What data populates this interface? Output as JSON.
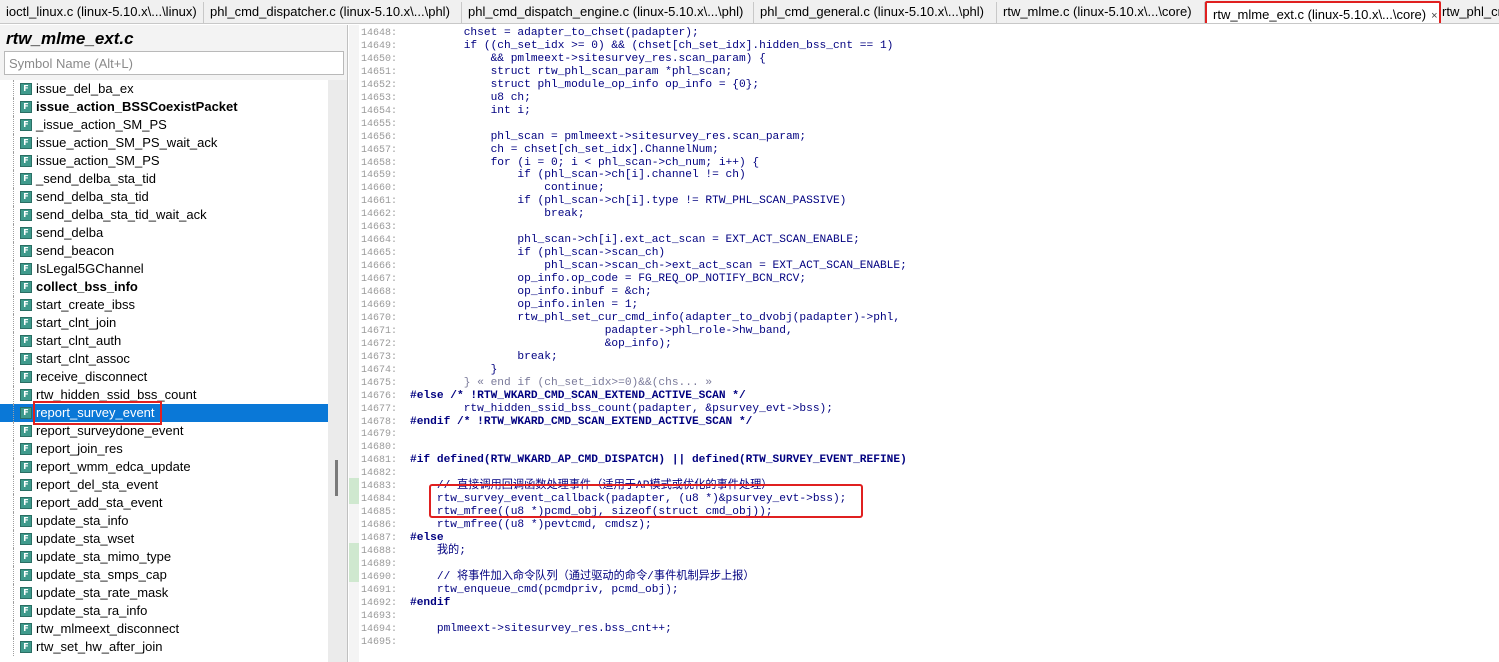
{
  "tabs": [
    {
      "label": "ioctl_linux.c (linux-5.10.x\\...\\linux)",
      "active": false
    },
    {
      "label": "phl_cmd_dispatcher.c (linux-5.10.x\\...\\phl)",
      "active": false
    },
    {
      "label": "phl_cmd_dispatch_engine.c (linux-5.10.x\\...\\phl)",
      "active": false
    },
    {
      "label": "phl_cmd_general.c (linux-5.10.x\\...\\phl)",
      "active": false
    },
    {
      "label": "rtw_mlme.c (linux-5.10.x\\...\\core)",
      "active": false
    },
    {
      "label": "rtw_mlme_ext.c (linux-5.10.x\\...\\core)",
      "active": true
    },
    {
      "label": "rtw_phl_cn",
      "active": false
    }
  ],
  "tab_close_glyph": "×",
  "sidebar": {
    "title": "rtw_mlme_ext.c",
    "search_placeholder": "Symbol Name (Alt+L)",
    "symbols": [
      {
        "label": "issue_del_ba_ex",
        "bold": false
      },
      {
        "label": "issue_action_BSSCoexistPacket",
        "bold": true
      },
      {
        "label": "_issue_action_SM_PS",
        "bold": false
      },
      {
        "label": "issue_action_SM_PS_wait_ack",
        "bold": false
      },
      {
        "label": "issue_action_SM_PS",
        "bold": false
      },
      {
        "label": "_send_delba_sta_tid",
        "bold": false
      },
      {
        "label": "send_delba_sta_tid",
        "bold": false
      },
      {
        "label": "send_delba_sta_tid_wait_ack",
        "bold": false
      },
      {
        "label": "send_delba",
        "bold": false
      },
      {
        "label": "send_beacon",
        "bold": false
      },
      {
        "label": "IsLegal5GChannel",
        "bold": false
      },
      {
        "label": "collect_bss_info",
        "bold": true
      },
      {
        "label": "start_create_ibss",
        "bold": false
      },
      {
        "label": "start_clnt_join",
        "bold": false
      },
      {
        "label": "start_clnt_auth",
        "bold": false
      },
      {
        "label": "start_clnt_assoc",
        "bold": false
      },
      {
        "label": "receive_disconnect",
        "bold": false
      },
      {
        "label": "rtw_hidden_ssid_bss_count",
        "bold": false
      },
      {
        "label": "report_survey_event",
        "bold": false,
        "selected": true
      },
      {
        "label": "report_surveydone_event",
        "bold": false
      },
      {
        "label": "report_join_res",
        "bold": false
      },
      {
        "label": "report_wmm_edca_update",
        "bold": false
      },
      {
        "label": "report_del_sta_event",
        "bold": false
      },
      {
        "label": "report_add_sta_event",
        "bold": false
      },
      {
        "label": "update_sta_info",
        "bold": false
      },
      {
        "label": "update_sta_wset",
        "bold": false
      },
      {
        "label": "update_sta_mimo_type",
        "bold": false
      },
      {
        "label": "update_sta_smps_cap",
        "bold": false
      },
      {
        "label": "update_sta_rate_mask",
        "bold": false
      },
      {
        "label": "update_sta_ra_info",
        "bold": false
      },
      {
        "label": "rtw_mlmeext_disconnect",
        "bold": false
      },
      {
        "label": "rtw_set_hw_after_join",
        "bold": false
      }
    ]
  },
  "editor": {
    "lines": [
      {
        "num": "14648:",
        "text": "        chset = adapter_to_chset(padapter);"
      },
      {
        "num": "14649:",
        "text": "        if ((ch_set_idx >= 0) && (chset[ch_set_idx].hidden_bss_cnt == 1)"
      },
      {
        "num": "14650:",
        "text": "            && pmlmeext->sitesurvey_res.scan_param) {"
      },
      {
        "num": "14651:",
        "text": "            struct rtw_phl_scan_param *phl_scan;"
      },
      {
        "num": "14652:",
        "text": "            struct phl_module_op_info op_info = {0};"
      },
      {
        "num": "14653:",
        "text": "            u8 ch;"
      },
      {
        "num": "14654:",
        "text": "            int i;"
      },
      {
        "num": "14655:",
        "text": ""
      },
      {
        "num": "14656:",
        "text": "            phl_scan = pmlmeext->sitesurvey_res.scan_param;"
      },
      {
        "num": "14657:",
        "text": "            ch = chset[ch_set_idx].ChannelNum;"
      },
      {
        "num": "14658:",
        "text": "            for (i = 0; i < phl_scan->ch_num; i++) {"
      },
      {
        "num": "14659:",
        "text": "                if (phl_scan->ch[i].channel != ch)"
      },
      {
        "num": "14660:",
        "text": "                    continue;"
      },
      {
        "num": "14661:",
        "text": "                if (phl_scan->ch[i].type != RTW_PHL_SCAN_PASSIVE)"
      },
      {
        "num": "14662:",
        "text": "                    break;"
      },
      {
        "num": "14663:",
        "text": ""
      },
      {
        "num": "14664:",
        "text": "                phl_scan->ch[i].ext_act_scan = EXT_ACT_SCAN_ENABLE;"
      },
      {
        "num": "14665:",
        "text": "                if (phl_scan->scan_ch)"
      },
      {
        "num": "14666:",
        "text": "                    phl_scan->scan_ch->ext_act_scan = EXT_ACT_SCAN_ENABLE;"
      },
      {
        "num": "14667:",
        "text": "                op_info.op_code = FG_REQ_OP_NOTIFY_BCN_RCV;"
      },
      {
        "num": "14668:",
        "text": "                op_info.inbuf = &ch;"
      },
      {
        "num": "14669:",
        "text": "                op_info.inlen = 1;"
      },
      {
        "num": "14670:",
        "text": "                rtw_phl_set_cur_cmd_info(adapter_to_dvobj(padapter)->phl,"
      },
      {
        "num": "14671:",
        "text": "                             padapter->phl_role->hw_band,"
      },
      {
        "num": "14672:",
        "text": "                             &op_info);"
      },
      {
        "num": "14673:",
        "text": "                break;"
      },
      {
        "num": "14674:",
        "text": "            }"
      },
      {
        "num": "14675:",
        "text": "        } « end if (ch_set_idx>=0)&&(chs... »"
      },
      {
        "num": "14676:",
        "text": "#else /* !RTW_WKARD_CMD_SCAN_EXTEND_ACTIVE_SCAN */"
      },
      {
        "num": "14677:",
        "text": "        rtw_hidden_ssid_bss_count(padapter, &psurvey_evt->bss);"
      },
      {
        "num": "14678:",
        "text": "#endif /* !RTW_WKARD_CMD_SCAN_EXTEND_ACTIVE_SCAN */"
      },
      {
        "num": "14679:",
        "text": ""
      },
      {
        "num": "14680:",
        "text": ""
      },
      {
        "num": "14681:",
        "text": "#if defined(RTW_WKARD_AP_CMD_DISPATCH) || defined(RTW_SURVEY_EVENT_REFINE)"
      },
      {
        "num": "14682:",
        "text": ""
      },
      {
        "num": "14683:",
        "text": "    // 直接调用回调函数处理事件（适用于AP模式或优化的事件处理）"
      },
      {
        "num": "14684:",
        "text": "    rtw_survey_event_callback(padapter, (u8 *)&psurvey_evt->bss);"
      },
      {
        "num": "14685:",
        "text": "    rtw_mfree((u8 *)pcmd_obj, sizeof(struct cmd_obj));"
      },
      {
        "num": "14686:",
        "text": "    rtw_mfree((u8 *)pevtcmd, cmdsz);"
      },
      {
        "num": "14687:",
        "text": "#else"
      },
      {
        "num": "14688:",
        "text": "    我的;"
      },
      {
        "num": "14689:",
        "text": ""
      },
      {
        "num": "14690:",
        "text": "    // 将事件加入命令队列（通过驱动的命令/事件机制异步上报）"
      },
      {
        "num": "14691:",
        "text": "    rtw_enqueue_cmd(pcmdpriv, pcmd_obj);"
      },
      {
        "num": "14692:",
        "text": "#endif"
      },
      {
        "num": "14693:",
        "text": ""
      },
      {
        "num": "14694:",
        "text": "    pmlmeext->sitesurvey_res.bss_cnt++;"
      },
      {
        "num": "14695:",
        "text": ""
      }
    ]
  }
}
